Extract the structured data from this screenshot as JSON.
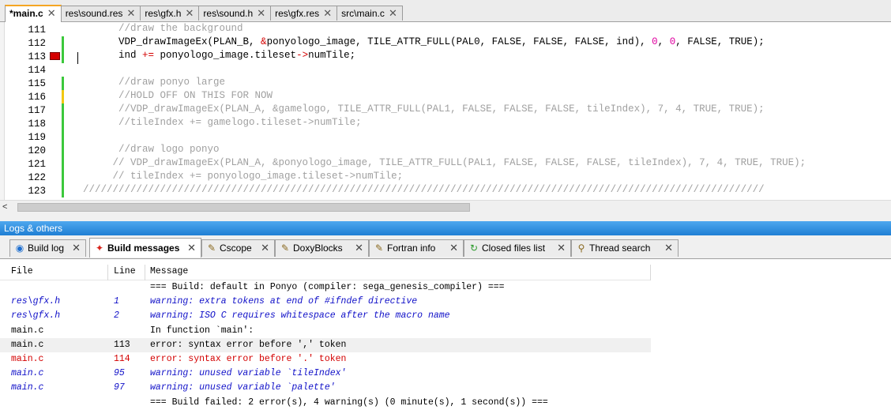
{
  "editor_tabs": [
    {
      "label": "*main.c",
      "active": true
    },
    {
      "label": "res\\sound.res",
      "active": false
    },
    {
      "label": "res\\gfx.h",
      "active": false
    },
    {
      "label": "res\\sound.h",
      "active": false
    },
    {
      "label": "res\\gfx.res",
      "active": false
    },
    {
      "label": "src\\main.c",
      "active": false
    }
  ],
  "close_glyph": "✕",
  "editor": {
    "lines": [
      {
        "num": "111",
        "segments": [
          {
            "t": "        ",
            "c": ""
          },
          {
            "t": "//draw the background",
            "c": "cmt"
          }
        ]
      },
      {
        "num": "112",
        "segments": [
          {
            "t": "        VDP_drawImageEx(PLAN_B, ",
            "c": ""
          },
          {
            "t": "&",
            "c": "red"
          },
          {
            "t": "ponyologo_image, TILE_ATTR_FULL(PAL0, FALSE, FALSE, FALSE, ind), ",
            "c": ""
          },
          {
            "t": "0",
            "c": "pink"
          },
          {
            "t": ", ",
            "c": ""
          },
          {
            "t": "0",
            "c": "pink"
          },
          {
            "t": ", FALSE, TRUE);",
            "c": ""
          }
        ]
      },
      {
        "num": "113",
        "segments": [
          {
            "t": "        ind ",
            "c": ""
          },
          {
            "t": "+=",
            "c": "red"
          },
          {
            "t": " ponyologo_image.tileset",
            "c": ""
          },
          {
            "t": "->",
            "c": "red"
          },
          {
            "t": "numTile;",
            "c": ""
          }
        ]
      },
      {
        "num": "114",
        "segments": [
          {
            "t": "",
            "c": ""
          }
        ]
      },
      {
        "num": "115",
        "segments": [
          {
            "t": "        ",
            "c": ""
          },
          {
            "t": "//draw ponyo large",
            "c": "cmt"
          }
        ]
      },
      {
        "num": "116",
        "segments": [
          {
            "t": "        ",
            "c": ""
          },
          {
            "t": "//HOLD OFF ON THIS FOR NOW",
            "c": "cmt"
          }
        ]
      },
      {
        "num": "117",
        "segments": [
          {
            "t": "        ",
            "c": ""
          },
          {
            "t": "//VDP_drawImageEx(PLAN_A, &gamelogo, TILE_ATTR_FULL(PAL1, FALSE, FALSE, FALSE, tileIndex), 7, 4, TRUE, TRUE);",
            "c": "cmt"
          }
        ]
      },
      {
        "num": "118",
        "segments": [
          {
            "t": "        ",
            "c": ""
          },
          {
            "t": "//tileIndex += gamelogo.tileset->numTile;",
            "c": "cmt"
          }
        ]
      },
      {
        "num": "119",
        "segments": [
          {
            "t": "",
            "c": ""
          }
        ]
      },
      {
        "num": "120",
        "segments": [
          {
            "t": "        ",
            "c": ""
          },
          {
            "t": "//draw logo ponyo",
            "c": "cmt"
          }
        ]
      },
      {
        "num": "121",
        "segments": [
          {
            "t": "       ",
            "c": ""
          },
          {
            "t": "// VDP_drawImageEx(PLAN_A, &ponyologo_image, TILE_ATTR_FULL(PAL1, FALSE, FALSE, FALSE, tileIndex), 7, 4, TRUE, TRUE);",
            "c": "cmt"
          }
        ]
      },
      {
        "num": "122",
        "segments": [
          {
            "t": "       ",
            "c": ""
          },
          {
            "t": "// tileIndex += ponyologo_image.tileset->numTile;",
            "c": "cmt"
          }
        ]
      },
      {
        "num": "123",
        "segments": [
          {
            "t": "  ",
            "c": ""
          },
          {
            "t": "///////////////////////////////////////////////////////////////////////////////////////////////////////////////////",
            "c": "cmt"
          }
        ]
      }
    ],
    "error_marker_line": "113",
    "change_bars": [
      {
        "line": "112",
        "color": "#3cc83c"
      },
      {
        "line": "113",
        "color": "#3cc83c"
      },
      {
        "line": "115",
        "color": "#3cc83c"
      },
      {
        "line": "116",
        "color": "#f2c811"
      },
      {
        "line": "117",
        "color": "#3cc83c"
      },
      {
        "line": "118",
        "color": "#3cc83c"
      },
      {
        "line": "119",
        "color": "#3cc83c"
      },
      {
        "line": "120",
        "color": "#3cc83c"
      },
      {
        "line": "121",
        "color": "#3cc83c"
      },
      {
        "line": "122",
        "color": "#3cc83c"
      },
      {
        "line": "123",
        "color": "#3cc83c"
      }
    ]
  },
  "scroll_left_glyph": "<",
  "logs": {
    "title": "Logs & others",
    "tabs": [
      {
        "label": "Build log",
        "icon": "build-log-icon",
        "glyph": "◉",
        "active": false
      },
      {
        "label": "Build messages",
        "icon": "build-messages-icon",
        "glyph": "✦",
        "active": true
      },
      {
        "label": "Cscope",
        "icon": "cscope-icon",
        "glyph": "✎",
        "active": false
      },
      {
        "label": "DoxyBlocks",
        "icon": "doxyblocks-icon",
        "glyph": "✎",
        "active": false
      },
      {
        "label": "Fortran info",
        "icon": "fortran-info-icon",
        "glyph": "✎",
        "active": false
      },
      {
        "label": "Closed files list",
        "icon": "closed-files-icon",
        "glyph": "↻",
        "active": false
      },
      {
        "label": "Thread search",
        "icon": "thread-search-icon",
        "glyph": "⚲",
        "active": false
      }
    ],
    "columns": {
      "file": "File",
      "line": "Line",
      "message": "Message"
    },
    "rows": [
      {
        "file": "",
        "line": "",
        "message": "=== Build: default in Ponyo (compiler: sega_genesis_compiler) ===",
        "style": "black",
        "selected": false
      },
      {
        "file": "res\\gfx.h",
        "line": "1",
        "message": "warning: extra tokens at end of #ifndef directive",
        "style": "blue",
        "selected": false
      },
      {
        "file": "res\\gfx.h",
        "line": "2",
        "message": "warning: ISO C requires whitespace after the macro name",
        "style": "blue",
        "selected": false
      },
      {
        "file": "main.c",
        "line": "",
        "message": "In function `main':",
        "style": "black",
        "selected": false
      },
      {
        "file": "main.c",
        "line": "113",
        "message": "error: syntax error before ',' token",
        "style": "black",
        "selected": true
      },
      {
        "file": "main.c",
        "line": "114",
        "message": "error: syntax error before '.' token",
        "style": "red",
        "selected": false
      },
      {
        "file": "main.c",
        "line": "95",
        "message": "warning: unused variable `tileIndex'",
        "style": "blue",
        "selected": false
      },
      {
        "file": "main.c",
        "line": "97",
        "message": "warning: unused variable `palette'",
        "style": "blue",
        "selected": false
      },
      {
        "file": "",
        "line": "",
        "message": "=== Build failed: 2 error(s), 4 warning(s) (0 minute(s), 1 second(s)) ===",
        "style": "black",
        "selected": false
      }
    ]
  }
}
